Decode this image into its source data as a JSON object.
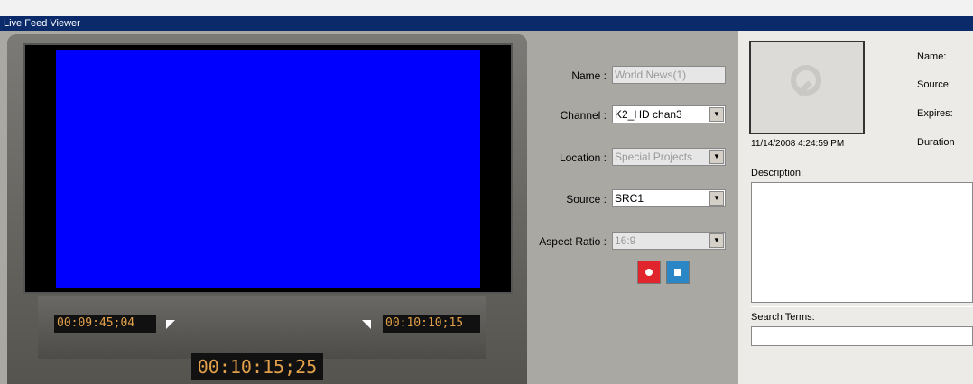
{
  "window": {
    "title": "Live Feed Viewer"
  },
  "timecodes": {
    "in": "00:09:45;04",
    "out": "00:10:10;15",
    "current": "00:10:15;25"
  },
  "form": {
    "name_label": "Name :",
    "name_value": "World News(1)",
    "channel_label": "Channel :",
    "channel_value": "K2_HD chan3",
    "location_label": "Location :",
    "location_value": "Special Projects",
    "source_label": "Source :",
    "source_value": "SRC1",
    "aspect_label": "Aspect Ratio :",
    "aspect_value": "16:9"
  },
  "info": {
    "date": "11/14/2008 4:24:59 PM",
    "name_label": "Name:",
    "source_label": "Source:",
    "expires_label": "Expires:",
    "duration_label": "Duration",
    "description_label": "Description:",
    "search_label": "Search Terms:"
  },
  "colors": {
    "record": "#e0262c",
    "stop": "#2b86c6",
    "video": "#0000ff",
    "timecode_text": "#e2a04a"
  }
}
